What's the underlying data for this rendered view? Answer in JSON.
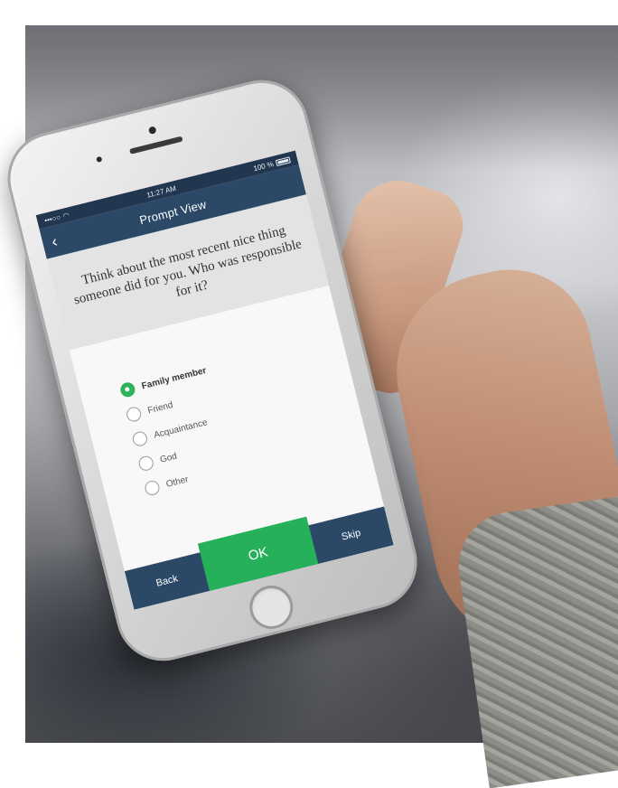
{
  "status_bar": {
    "carrier": "•••○○",
    "time": "11:27 AM",
    "battery": "100 %"
  },
  "nav": {
    "back_icon": "chevron-left-icon",
    "title": "Prompt View"
  },
  "prompt": {
    "text": "Think about the most recent nice thing someone did for you.  Who was responsible for it?"
  },
  "options": [
    {
      "label": "Family member",
      "selected": true
    },
    {
      "label": "Friend",
      "selected": false
    },
    {
      "label": "Acquaintance",
      "selected": false
    },
    {
      "label": "God",
      "selected": false
    },
    {
      "label": "Other",
      "selected": false
    }
  ],
  "bottom_bar": {
    "back_label": "Back",
    "ok_label": "OK",
    "skip_label": "Skip"
  },
  "colors": {
    "nav_blue": "#2b4866",
    "status_blue": "#22374f",
    "accent_green": "#27b05a"
  }
}
